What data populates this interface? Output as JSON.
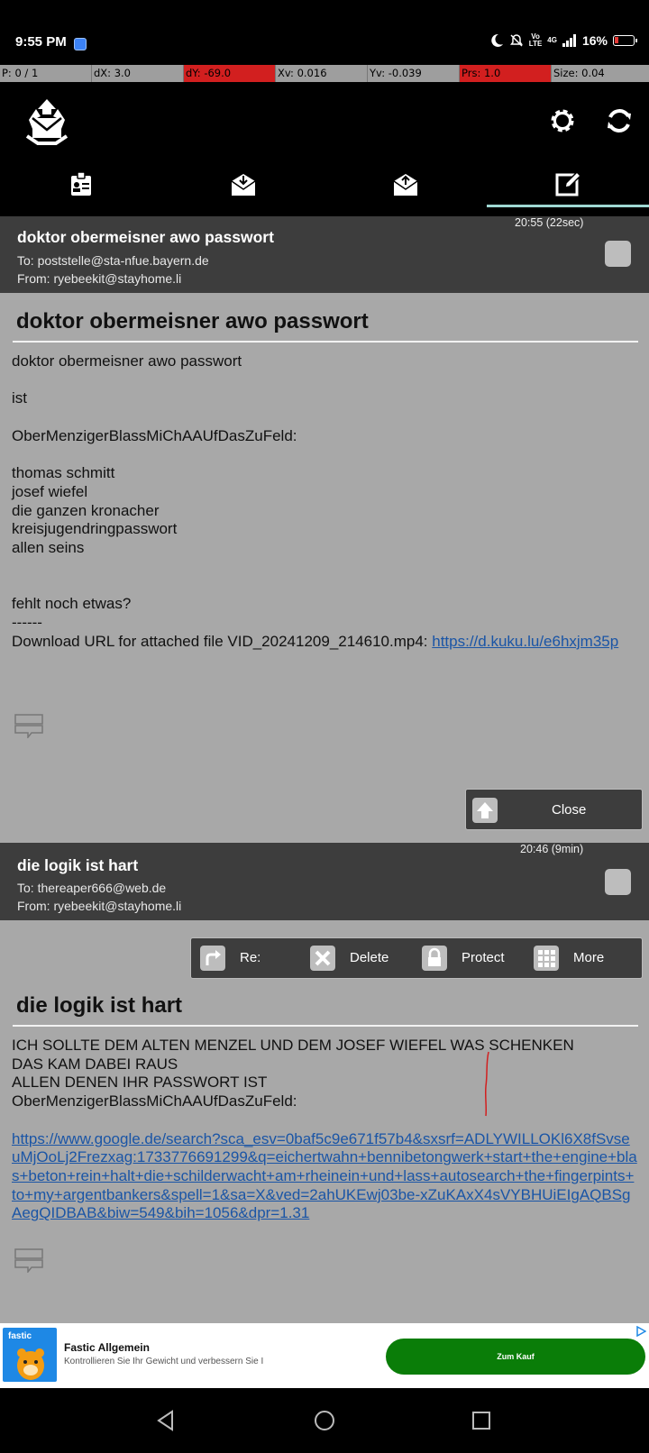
{
  "status_bar": {
    "time": "9:55 PM",
    "net_top": "Vo",
    "net_bottom": "LTE",
    "net_gen": "4G",
    "battery": "16%"
  },
  "debug": [
    "P: 0 / 1",
    "dX: 3.0",
    "dY: -69.0",
    "Xv: 0.016",
    "Yv: -0.039",
    "Prs: 1.0",
    "Size: 0.04"
  ],
  "tabs": [
    "contacts",
    "inbox",
    "outbox",
    "compose"
  ],
  "messages": [
    {
      "subject": "doktor obermeisner awo passwort",
      "to": "To: poststelle@sta-nfue.bayern.de",
      "from": "From: ryebeekit@stayhome.li",
      "time": "20:55 (22sec)",
      "body": [
        "doktor obermeisner awo passwort",
        "",
        "ist",
        "",
        "OberMenzigerBlassMiChAAUfDasZuFeld:",
        "",
        "thomas schmitt",
        "josef wiefel",
        "die ganzen kronacher",
        "kreisjugendringpasswort",
        "allen seins",
        "",
        "",
        "fehlt noch etwas?",
        "------"
      ],
      "attachment_text": "Download URL for attached file VID_20241209_214610.mp4: ",
      "attachment_link": "https://d.kuku.lu/e6hxjm35p"
    },
    {
      "subject": "die logik ist hart",
      "to": "To: thereaper666@web.de",
      "from": "From: ryebeekit@stayhome.li",
      "time": "20:46 (9min)",
      "body": [
        "ICH SOLLTE DEM ALTEN MENZEL UND DEM JOSEF WIEFEL WAS SCHENKEN",
        "DAS KAM DABEI RAUS",
        "ALLEN DENEN IHR PASSWORT IST",
        "OberMenzigerBlassMiChAAUfDasZuFeld:",
        ""
      ],
      "link": "https://www.google.de/search?sca_esv=0baf5c9e671f57b4&sxsrf=ADLYWILLOKl6X8fSvseuMjOoLj2Frezxag:1733776691299&q=eichertwahn+bennibetongwerk+start+the+engine+blas+beton+rein+halt+die+schilderwacht+am+rheinein+und+lass+autosearch+the+fingerpints+to+my+argentbankers&spell=1&sa=X&ved=2ahUKEwj03be-xZuKAxX4sVYBHUiEIgAQBSgAegQIDBAB&biw=549&bih=1056&dpr=1.31"
    }
  ],
  "close_button": "Close",
  "actions": [
    "Re:",
    "Delete",
    "Protect",
    "More"
  ],
  "ad": {
    "brand": "fastic",
    "title": "Fastic Allgemein",
    "subtitle": "Kontrollieren Sie Ihr Gewicht und verbessern Sie I",
    "button": "Zum Kauf"
  }
}
